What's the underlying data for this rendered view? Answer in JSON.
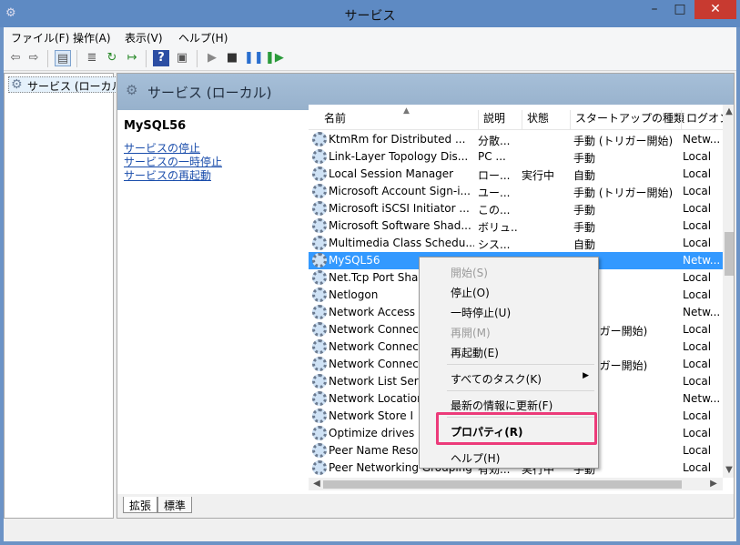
{
  "window": {
    "title": "サービス"
  },
  "menubar": {
    "items": [
      "ファイル(F)",
      "操作(A)",
      "表示(V)",
      "ヘルプ(H)"
    ]
  },
  "toolbar": {
    "icons": [
      "back-icon",
      "forward-icon",
      "show-hide-tree-icon",
      "properties-icon",
      "refresh-icon",
      "export-icon",
      "help-icon",
      "console-icon",
      "play-icon",
      "stop-icon",
      "pause-icon",
      "restart-icon"
    ]
  },
  "tree": {
    "root_label": "サービス (ローカル)"
  },
  "banner": {
    "title": "サービス (ローカル)"
  },
  "detail": {
    "service_name": "MySQL56",
    "links": [
      "サービスの停止",
      "サービスの一時停止",
      "サービスの再起動"
    ]
  },
  "list": {
    "columns": [
      "名前",
      "説明",
      "状態",
      "スタートアップの種類",
      "ログオン"
    ],
    "rows": [
      {
        "name": "KtmRm for Distributed ...",
        "desc": "分散...",
        "state": "",
        "startup": "手動 (トリガー開始)",
        "logon": "Netw..."
      },
      {
        "name": "Link-Layer Topology Dis...",
        "desc": "PC ...",
        "state": "",
        "startup": "手動",
        "logon": "Local"
      },
      {
        "name": "Local Session Manager",
        "desc": "ロー...",
        "state": "実行中",
        "startup": "自動",
        "logon": "Local"
      },
      {
        "name": "Microsoft Account Sign-i...",
        "desc": "ユー...",
        "state": "",
        "startup": "手動 (トリガー開始)",
        "logon": "Local"
      },
      {
        "name": "Microsoft iSCSI Initiator ...",
        "desc": "この...",
        "state": "",
        "startup": "手動",
        "logon": "Local"
      },
      {
        "name": "Microsoft Software Shad...",
        "desc": "ボリュ...",
        "state": "",
        "startup": "手動",
        "logon": "Local"
      },
      {
        "name": "Multimedia Class Schedu...",
        "desc": "シス...",
        "state": "",
        "startup": "自動",
        "logon": "Local"
      },
      {
        "name": "MySQL56",
        "desc": "",
        "state": "",
        "startup": "",
        "logon": "Netw...",
        "selected": true
      },
      {
        "name": "Net.Tcp Port Sha",
        "desc": "",
        "state": "",
        "startup": "",
        "logon": "Local"
      },
      {
        "name": "Netlogon",
        "desc": "",
        "state": "",
        "startup": "",
        "logon": "Local"
      },
      {
        "name": "Network Access",
        "desc": "",
        "state": "",
        "startup": "",
        "logon": "Netw..."
      },
      {
        "name": "Network Connec",
        "desc": "",
        "state": "",
        "startup": "(トリガー開始)",
        "logon": "Local"
      },
      {
        "name": "Network Connec",
        "desc": "",
        "state": "",
        "startup": "",
        "logon": "Local"
      },
      {
        "name": "Network Connec",
        "desc": "",
        "state": "",
        "startup": "(トリガー開始)",
        "logon": "Local"
      },
      {
        "name": "Network List Ser",
        "desc": "",
        "state": "",
        "startup": "",
        "logon": "Local"
      },
      {
        "name": "Network Location",
        "desc": "",
        "state": "",
        "startup": "",
        "logon": "Netw..."
      },
      {
        "name": "Network Store I",
        "desc": "",
        "state": "",
        "startup": "",
        "logon": "Local"
      },
      {
        "name": "Optimize drives",
        "desc": "",
        "state": "",
        "startup": "",
        "logon": "Local"
      },
      {
        "name": "Peer Name Reso",
        "desc": "",
        "state": "",
        "startup": "",
        "logon": "Local"
      },
      {
        "name": "Peer Networking Grouping",
        "desc": "有効...",
        "state": "実行中",
        "startup": "手動",
        "logon": "Local"
      }
    ]
  },
  "tabs": [
    "拡張",
    "標準"
  ],
  "context_menu": {
    "items": [
      {
        "label": "開始(S)",
        "disabled": true
      },
      {
        "label": "停止(O)"
      },
      {
        "label": "一時停止(U)"
      },
      {
        "label": "再開(M)",
        "disabled": true
      },
      {
        "label": "再起動(E)"
      },
      {
        "separator": true
      },
      {
        "label": "すべてのタスク(K)",
        "submenu": true
      },
      {
        "separator": true
      },
      {
        "label": "最新の情報に更新(F)"
      },
      {
        "separator": true
      },
      {
        "label": "プロパティ(R)",
        "bold": true,
        "highlighted": true
      },
      {
        "separator": true
      },
      {
        "label": "ヘルプ(H)"
      }
    ]
  },
  "colors": {
    "selection": "#3399ff",
    "highlight_box": "#ec3b7a",
    "link": "#1a4dab"
  }
}
